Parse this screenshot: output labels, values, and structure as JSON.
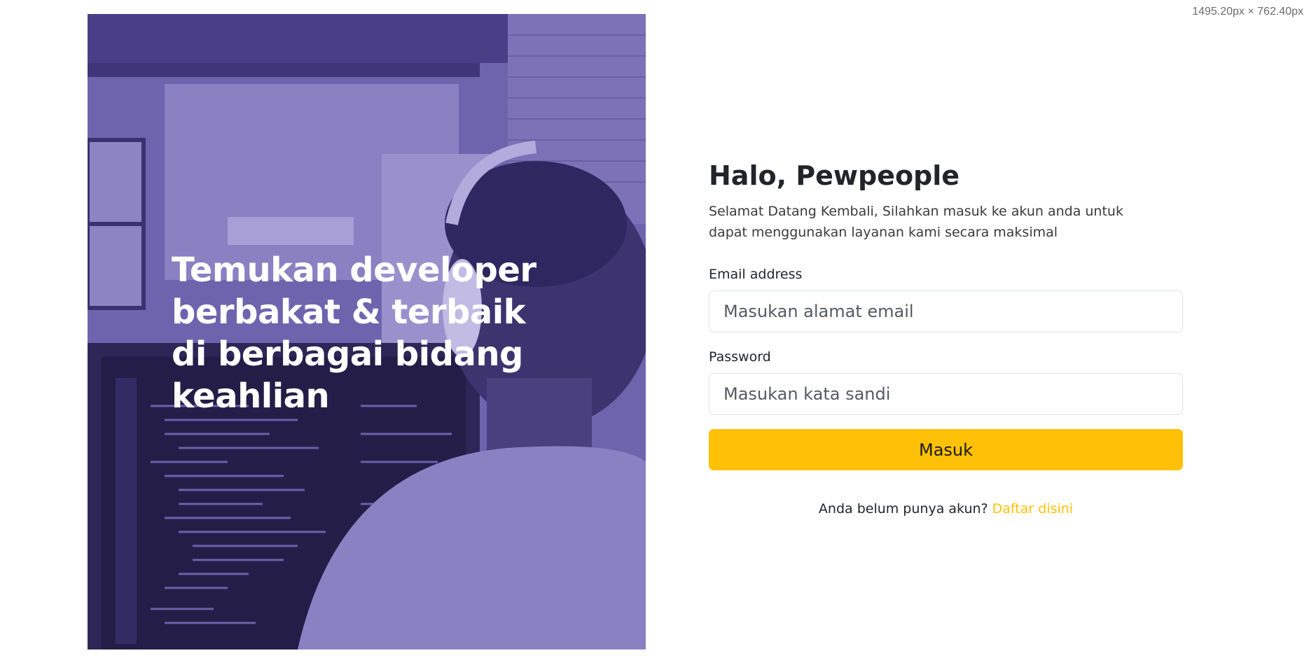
{
  "viewport_label": "1495.20px × 762.40px",
  "hero": {
    "headline": "Temukan developer berbakat & terbaik di berbagai bidang keahlian",
    "overlay_color": "#5b4f99"
  },
  "login": {
    "greeting": "Halo, Pewpeople",
    "subtitle": "Selamat Datang Kembali, Silahkan masuk ke akun anda untuk dapat menggunakan layanan kami secara maksimal",
    "email_label": "Email address",
    "email_placeholder": "Masukan alamat email",
    "email_value": "",
    "password_label": "Password",
    "password_placeholder": "Masukan kata sandi",
    "password_value": "",
    "submit_label": "Masuk",
    "register_prompt": "Anda belum punya akun?",
    "register_link": "Daftar disini"
  },
  "colors": {
    "accent": "#ffc107",
    "text": "#212529",
    "input_border": "#dee2e6"
  }
}
